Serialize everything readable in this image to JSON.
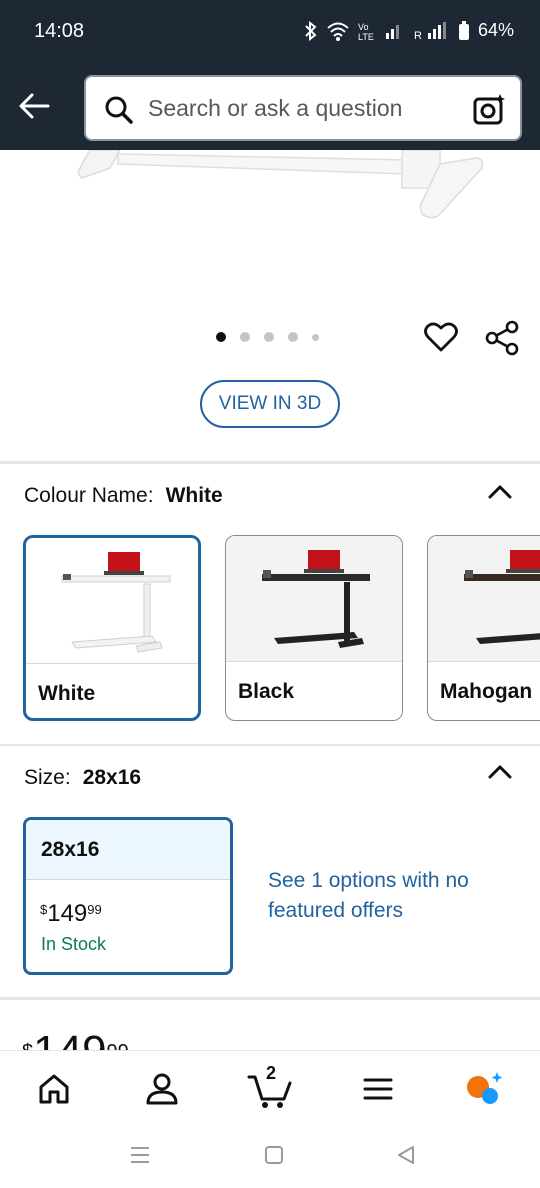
{
  "status_bar": {
    "time": "14:08",
    "battery": "64%"
  },
  "search": {
    "placeholder": "Search or ask a question"
  },
  "gallery": {
    "view_3d_label": "VIEW IN 3D",
    "page_count": 5,
    "active_page": 1
  },
  "colour": {
    "label": "Colour Name:",
    "selected": "White",
    "options": [
      {
        "name": "White"
      },
      {
        "name": "Black"
      },
      {
        "name": "Mahogan"
      }
    ]
  },
  "size": {
    "label": "Size:",
    "selected": "28x16",
    "card": {
      "name": "28x16",
      "currency": "$",
      "price_whole": "149",
      "price_fraction": "99",
      "stock": "In Stock"
    },
    "other_offers": "See 1 options with no featured offers"
  },
  "price": {
    "currency": "$",
    "whole": "149",
    "fraction": "99"
  },
  "navbar": {
    "cart_count": "2",
    "items": [
      "home-icon",
      "account-icon",
      "cart-icon",
      "menu-icon",
      "rufus-icon"
    ]
  },
  "colors": {
    "accent": "#2162a1",
    "header": "#1e2734",
    "stock": "#067d62"
  }
}
